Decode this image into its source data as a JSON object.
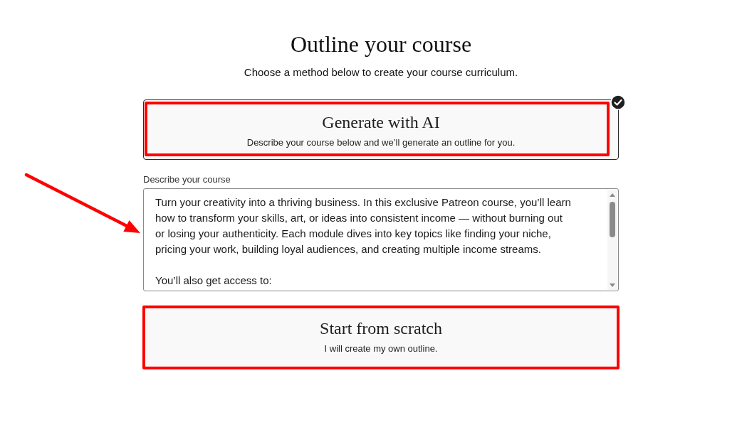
{
  "page": {
    "title": "Outline your course",
    "subtitle": "Choose a method below to create your course curriculum."
  },
  "methods": [
    {
      "title": "Generate with AI",
      "description": "Describe your course below and we’ll generate an outline for you.",
      "selected": true,
      "highlighted": true,
      "details": {
        "label": "Describe your course",
        "value": "Turn your creativity into a thriving business. In this exclusive Patreon course, you’ll learn how to transform your skills, art, or ideas into consistent income — without burning out or losing your authenticity. Each module dives into key topics like finding your niche, pricing your work, building loyal audiences, and creating multiple income streams.\n\nYou’ll also get access to:",
        "arrow": true
      }
    },
    {
      "title": "Start from scratch",
      "description": "I will create my own outline.",
      "selected": false,
      "highlighted": true
    }
  ]
}
